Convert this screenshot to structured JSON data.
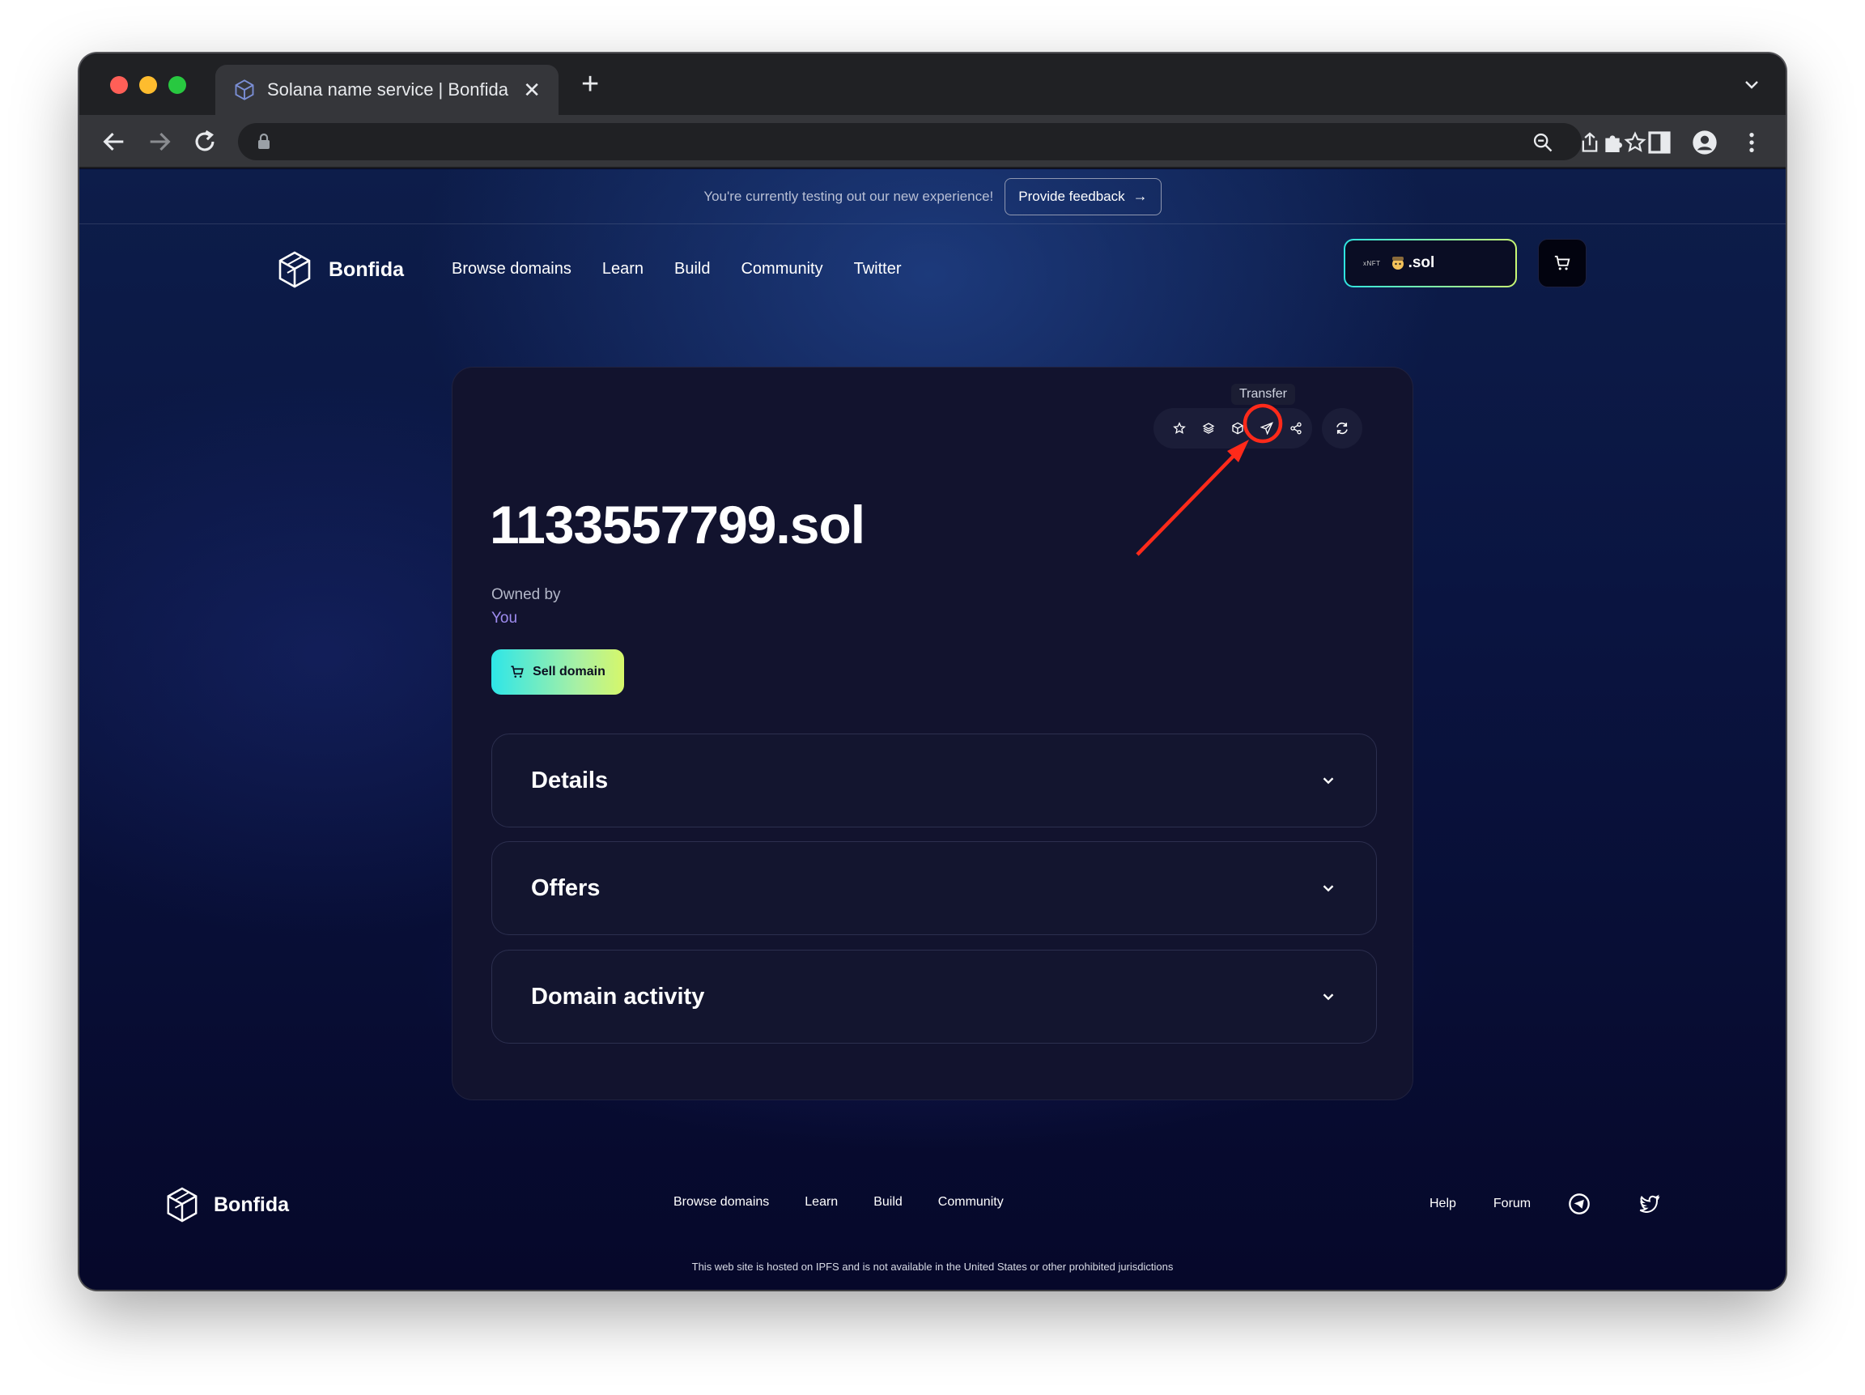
{
  "browser": {
    "tab_title": "Solana name service | Bonfida",
    "new_tab_symbol": "+",
    "close_symbol": "✕"
  },
  "banner": {
    "text": "You're currently testing out our new experience!",
    "feedback_label": "Provide feedback",
    "feedback_arrow": "→"
  },
  "header": {
    "brand": "Bonfida",
    "nav": [
      "Browse domains",
      "Learn",
      "Build",
      "Community",
      "Twitter"
    ],
    "wallet_badge": "xNFT",
    "wallet_name": ".sol"
  },
  "card": {
    "tooltip": "Transfer",
    "domain": "1133557799.sol",
    "owned_label": "Owned by",
    "owned_value": "You",
    "sell_label": "Sell domain",
    "sections": [
      "Details",
      "Offers",
      "Domain activity"
    ]
  },
  "footer": {
    "brand": "Bonfida",
    "links": [
      "Browse domains",
      "Learn",
      "Build",
      "Community"
    ],
    "right_links": [
      "Help",
      "Forum"
    ],
    "disclaimer": "This web site is hosted on IPFS and is not available in the United States or other prohibited jurisdictions"
  },
  "colors": {
    "accent_gradient_start": "#2ee6e8",
    "accent_gradient_end": "#d6f76a",
    "owner_link": "#9f8cf0",
    "annotation_red": "#ff2a1a"
  }
}
